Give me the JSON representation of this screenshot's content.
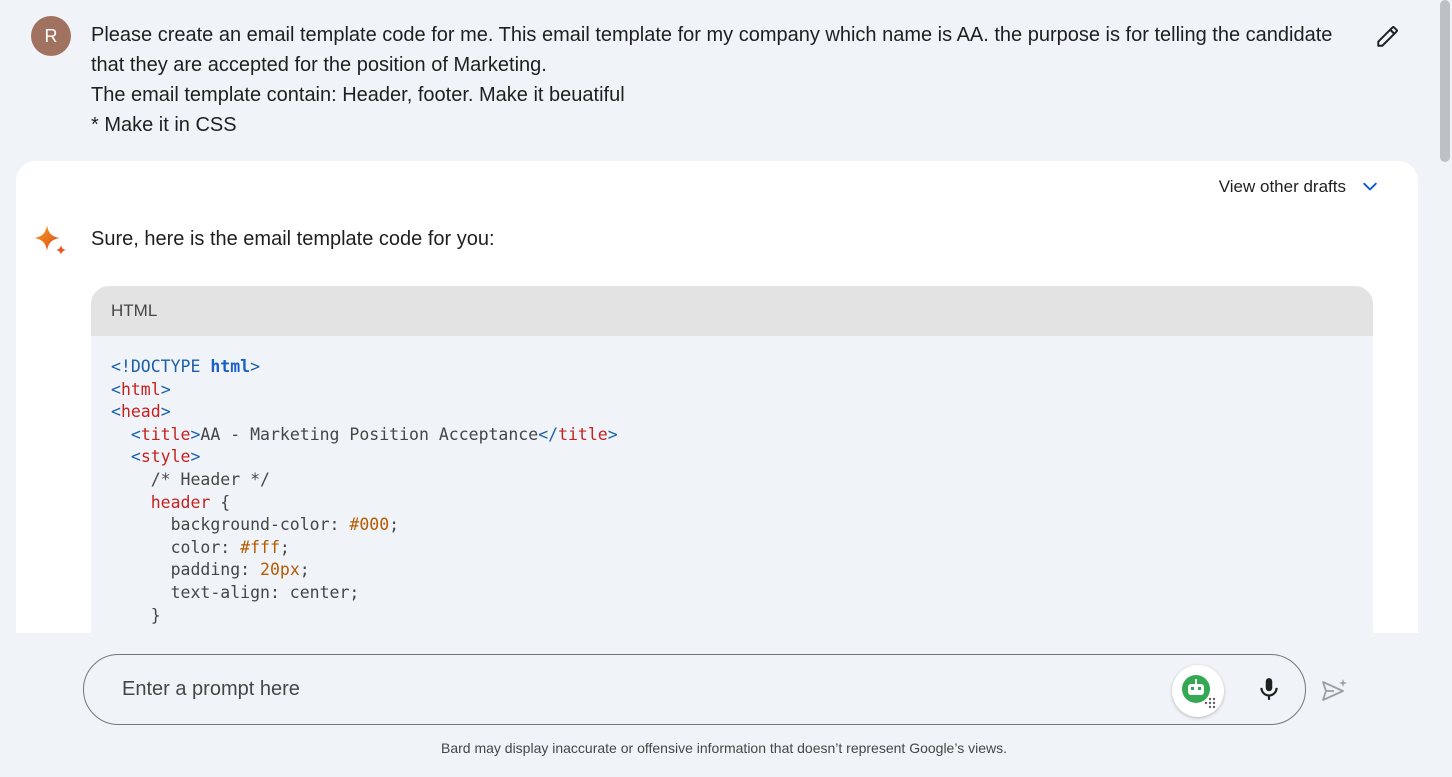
{
  "user_message": {
    "avatar_letter": "R",
    "lines": [
      "Please create an email template code for me. This email template for my company which name is AA. the purpose is for telling the candidate",
      "that they are accepted for the position of Marketing.",
      "The email template contain: Header, footer. Make it beuatiful",
      "* Make it in CSS"
    ],
    "edit_icon": "pencil-icon"
  },
  "response": {
    "view_drafts_label": "View other drafts",
    "drafts_icon": "chevron-down-icon",
    "assistant_icon": "sparkle-icon",
    "intro": "Sure, here is the email template code for you:",
    "code_block": {
      "language": "HTML",
      "lines": [
        [
          {
            "t": "<!DOCTYPE ",
            "c": "punct"
          },
          {
            "t": "html",
            "c": "kw"
          },
          {
            "t": ">",
            "c": "punct"
          }
        ],
        [
          {
            "t": "<",
            "c": "punct"
          },
          {
            "t": "html",
            "c": "tag"
          },
          {
            "t": ">",
            "c": "punct"
          }
        ],
        [
          {
            "t": "<",
            "c": "punct"
          },
          {
            "t": "head",
            "c": "tag"
          },
          {
            "t": ">",
            "c": "punct"
          }
        ],
        [
          {
            "t": "  <",
            "c": "punct"
          },
          {
            "t": "title",
            "c": "tag"
          },
          {
            "t": ">",
            "c": "punct"
          },
          {
            "t": "AA - Marketing Position Acceptance",
            "c": "text"
          },
          {
            "t": "</",
            "c": "punct"
          },
          {
            "t": "title",
            "c": "tag"
          },
          {
            "t": ">",
            "c": "punct"
          }
        ],
        [
          {
            "t": "  <",
            "c": "punct"
          },
          {
            "t": "style",
            "c": "tag"
          },
          {
            "t": ">",
            "c": "punct"
          }
        ],
        [
          {
            "t": "    /* Header */",
            "c": "comment"
          }
        ],
        [
          {
            "t": "    ",
            "c": "text"
          },
          {
            "t": "header",
            "c": "tag"
          },
          {
            "t": " {",
            "c": "text"
          }
        ],
        [
          {
            "t": "      background-color: ",
            "c": "text"
          },
          {
            "t": "#000",
            "c": "num"
          },
          {
            "t": ";",
            "c": "text"
          }
        ],
        [
          {
            "t": "      color: ",
            "c": "text"
          },
          {
            "t": "#fff",
            "c": "num"
          },
          {
            "t": ";",
            "c": "text"
          }
        ],
        [
          {
            "t": "      padding: ",
            "c": "text"
          },
          {
            "t": "20px",
            "c": "num"
          },
          {
            "t": ";",
            "c": "text"
          }
        ],
        [
          {
            "t": "      text-align: center;",
            "c": "text"
          }
        ],
        [
          {
            "t": "    }",
            "c": "text"
          }
        ]
      ]
    }
  },
  "prompt_bar": {
    "placeholder": "Enter a prompt here",
    "extension_icon": "robot-icon",
    "mic_icon": "microphone-icon",
    "send_icon": "send-icon"
  },
  "disclaimer": "Bard may display inaccurate or offensive information that doesn’t represent Google’s views.",
  "colors": {
    "background": "#f0f4f9",
    "avatar": "#a1725f",
    "accent": "#1a5fc8",
    "tag": "#c5221f",
    "number": "#b55a00"
  }
}
